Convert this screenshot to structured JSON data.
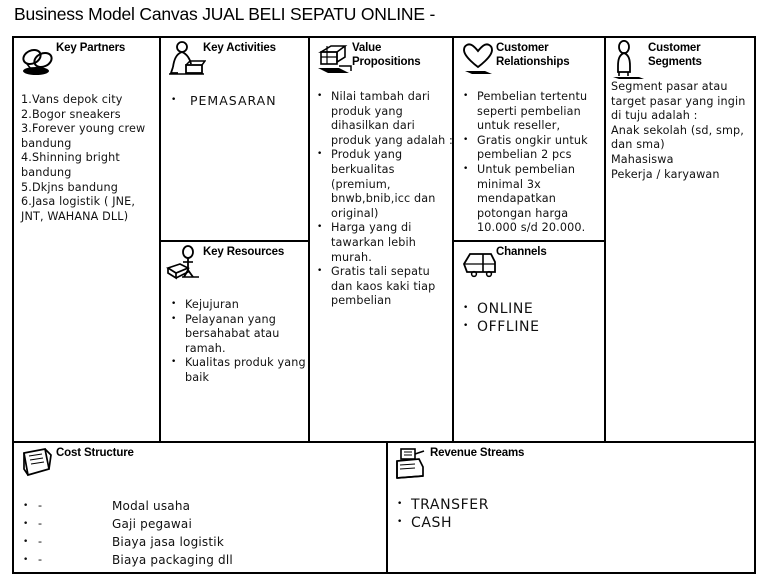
{
  "title": "Business Model Canvas JUAL BELI SEPATU ONLINE -",
  "blocks": {
    "key_partners": {
      "title": "Key Partners",
      "icon": "handshake-rings-icon",
      "items": [
        "1.Vans depok city",
        "2.Bogor sneakers",
        "3.Forever young crew bandung",
        "4.Shinning bright bandung",
        "5.Dkjns bandung",
        "6.Jasa logistik ( JNE, JNT, WAHANA DLL)"
      ]
    },
    "key_activities": {
      "title": "Key Activities",
      "icon": "person-pushing-block-icon",
      "items": [
        "PEMASARAN"
      ]
    },
    "key_resources": {
      "title": "Key Resources",
      "icon": "person-with-crate-icon",
      "items": [
        "Kejujuran",
        "Pelayanan yang bersahabat atau ramah.",
        "Kualitas produk yang baik"
      ]
    },
    "value_propositions": {
      "title": "Value Propositions",
      "icon": "gift-package-icon",
      "items": [
        "Nilai tambah dari produk yang dihasilkan dari produk yang adalah :",
        "Produk yang berkualitas (premium, bnwb,bnib,icc dan original)",
        "Harga yang di tawarkan lebih murah.",
        "Gratis tali sepatu dan kaos kaki tiap pembelian"
      ]
    },
    "customer_relationships": {
      "title": "Customer\nRelationships",
      "icon": "heart-icon",
      "items": [
        "Pembelian tertentu seperti pembelian untuk reseller,",
        "Gratis ongkir untuk pembelian 2 pcs",
        "Untuk pembelian minimal 3x mendapatkan potongan harga 10.000 s/d 20.000."
      ]
    },
    "channels": {
      "title": "Channels",
      "icon": "delivery-truck-icon",
      "items": [
        "ONLINE",
        "OFFLINE"
      ]
    },
    "customer_segments": {
      "title": "Customer Segments",
      "icon": "standing-person-icon",
      "lines": [
        "Segment pasar atau",
        "target pasar yang ingin",
        "di tuju adalah :",
        "Anak sekolah (sd, smp,",
        "dan sma)",
        "Mahasiswa",
        "Pekerja / karyawan"
      ]
    },
    "cost_structure": {
      "title": "Cost Structure",
      "icon": "paper-stack-icon",
      "dash": "-",
      "items": [
        "Modal usaha",
        "Gaji pegawai",
        "Biaya jasa logistik",
        "Biaya packaging dll"
      ]
    },
    "revenue_streams": {
      "title": "Revenue Streams",
      "icon": "cash-register-icon",
      "items": [
        "TRANSFER",
        "CASH"
      ]
    }
  },
  "colors": {
    "border": "#000000",
    "background": "#ffffff",
    "text": "#000000"
  }
}
